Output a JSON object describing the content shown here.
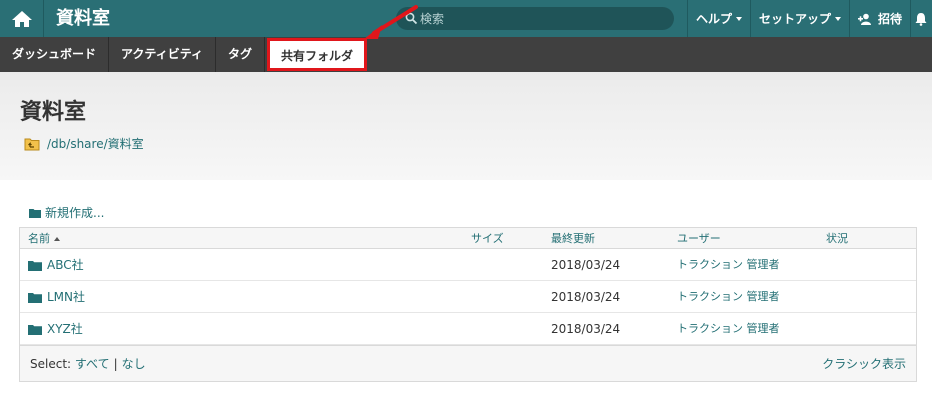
{
  "topbar": {
    "home_icon": "home-icon",
    "title": "資料室",
    "search_placeholder": "検索",
    "help_label": "ヘルプ",
    "setup_label": "セットアップ",
    "invite_label": "招待"
  },
  "tabs": [
    {
      "label": "ダッシュボード"
    },
    {
      "label": "アクティビティ"
    },
    {
      "label": "タグ"
    },
    {
      "label": "共有フォルダ"
    }
  ],
  "header": {
    "title": "資料室",
    "breadcrumb": "/db/share/資料室"
  },
  "actions": {
    "new_label": "新規作成..."
  },
  "table": {
    "columns": {
      "name": "名前",
      "size": "サイズ",
      "modified": "最終更新",
      "user": "ユーザー",
      "status": "状況"
    },
    "rows": [
      {
        "name": "ABC社",
        "modified": "2018/03/24",
        "user": "トラクション 管理者"
      },
      {
        "name": "LMN社",
        "modified": "2018/03/24",
        "user": "トラクション 管理者"
      },
      {
        "name": "XYZ社",
        "modified": "2018/03/24",
        "user": "トラクション 管理者"
      }
    ],
    "footer": {
      "select_label": "Select:",
      "select_all": "すべて",
      "select_none": "なし",
      "classic_view": "クラシック表示"
    }
  },
  "colors": {
    "accent": "#2a6f75",
    "link": "#236f74",
    "annotation": "#e0161b"
  }
}
